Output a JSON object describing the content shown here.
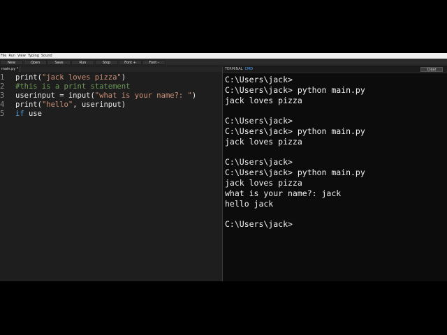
{
  "menu": [
    "File",
    "Run",
    "View",
    "Typing",
    "Sound"
  ],
  "toolbar": {
    "buttons": [
      "New",
      "Open",
      "Save",
      "Run",
      "Stop",
      "Font +",
      "Font -"
    ]
  },
  "editor": {
    "tab_label": "main.py *",
    "lines": [
      {
        "num": "1",
        "parts": [
          [
            "t",
            "print("
          ],
          [
            "s",
            "\"jack loves pizza\""
          ],
          [
            "t",
            ")"
          ]
        ]
      },
      {
        "num": "2",
        "parts": [
          [
            "c",
            "#this is a print statement"
          ]
        ]
      },
      {
        "num": "3",
        "parts": [
          [
            "t",
            "userinput = input("
          ],
          [
            "s",
            "\"what is your name?: \""
          ],
          [
            "t",
            ")"
          ]
        ]
      },
      {
        "num": "4",
        "parts": [
          [
            "t",
            "print("
          ],
          [
            "s",
            "\"hello\""
          ],
          [
            "t",
            ", userinput)"
          ]
        ]
      },
      {
        "num": "5",
        "parts": [
          [
            "k",
            "if"
          ],
          [
            "t",
            " use"
          ]
        ]
      }
    ]
  },
  "terminal": {
    "tabs": [
      "TERMINAL",
      "CMD"
    ],
    "clear_label": "Clear",
    "lines": [
      "C:\\Users\\jack>",
      "C:\\Users\\jack> python main.py",
      "jack loves pizza",
      "",
      "C:\\Users\\jack>",
      "C:\\Users\\jack> python main.py",
      "jack loves pizza",
      "",
      "C:\\Users\\jack>",
      "C:\\Users\\jack> python main.py",
      "jack loves pizza",
      "what is your name?: jack",
      "hello jack",
      "",
      "C:\\Users\\jack>"
    ]
  },
  "colors": {
    "string": "#ce9178",
    "comment": "#6a9955",
    "keyword": "#569cd6",
    "active_tab": "#4aa3ff"
  }
}
